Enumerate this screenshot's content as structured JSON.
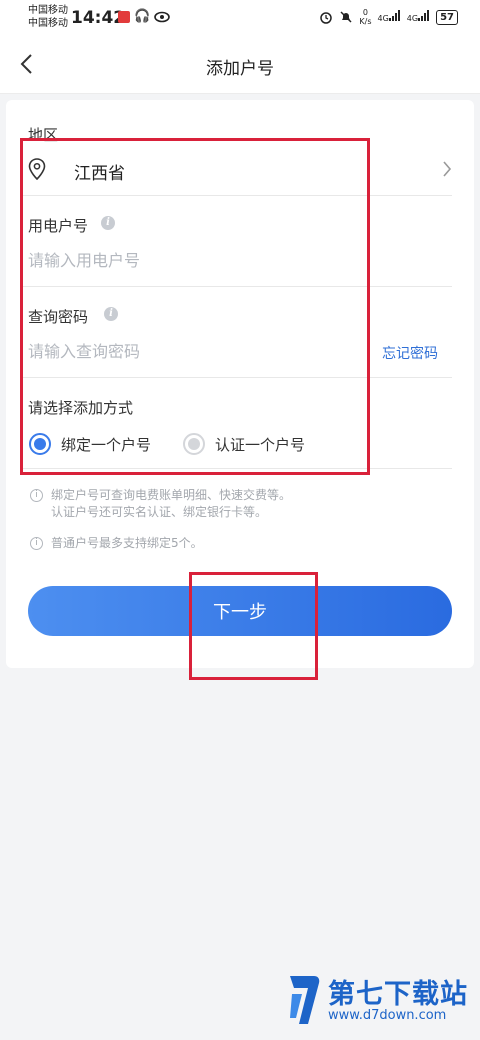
{
  "status_bar": {
    "carrier_1": "中国移动",
    "carrier_2": "中国移动",
    "time": "14:42",
    "net_speed_value": "0",
    "net_speed_unit": "K/s",
    "signal_1": "4G",
    "signal_2": "4G",
    "battery": "57"
  },
  "nav": {
    "title": "添加户号"
  },
  "form": {
    "region_label": "地区",
    "region_value": "江西省",
    "account_label": "用电户号",
    "account_placeholder": "请输入用电户号",
    "password_label": "查询密码",
    "password_placeholder": "请输入查询密码",
    "forgot_password": "忘记密码",
    "method_label": "请选择添加方式",
    "option_bind": "绑定一个户号",
    "option_verify": "认证一个户号",
    "selected_option": "绑定一个户号"
  },
  "notes": {
    "note_1_line_1": "绑定户号可查询电费账单明细、快速交费等。",
    "note_1_line_2": "认证户号还可实名认证、绑定银行卡等。",
    "note_2": "普通户号最多支持绑定5个。"
  },
  "actions": {
    "next_label": "下一步"
  },
  "watermark": {
    "name": "第七下载站",
    "url": "www.d7down.com"
  },
  "colors": {
    "accent": "#3a7bea",
    "link": "#2f6fd6",
    "annotation": "#d9213a",
    "watermark": "#1d64c8"
  },
  "icons": {
    "back": "chevron-left-icon",
    "region": "location-pin-icon",
    "region_more": "chevron-right-icon",
    "info": "info-icon"
  }
}
